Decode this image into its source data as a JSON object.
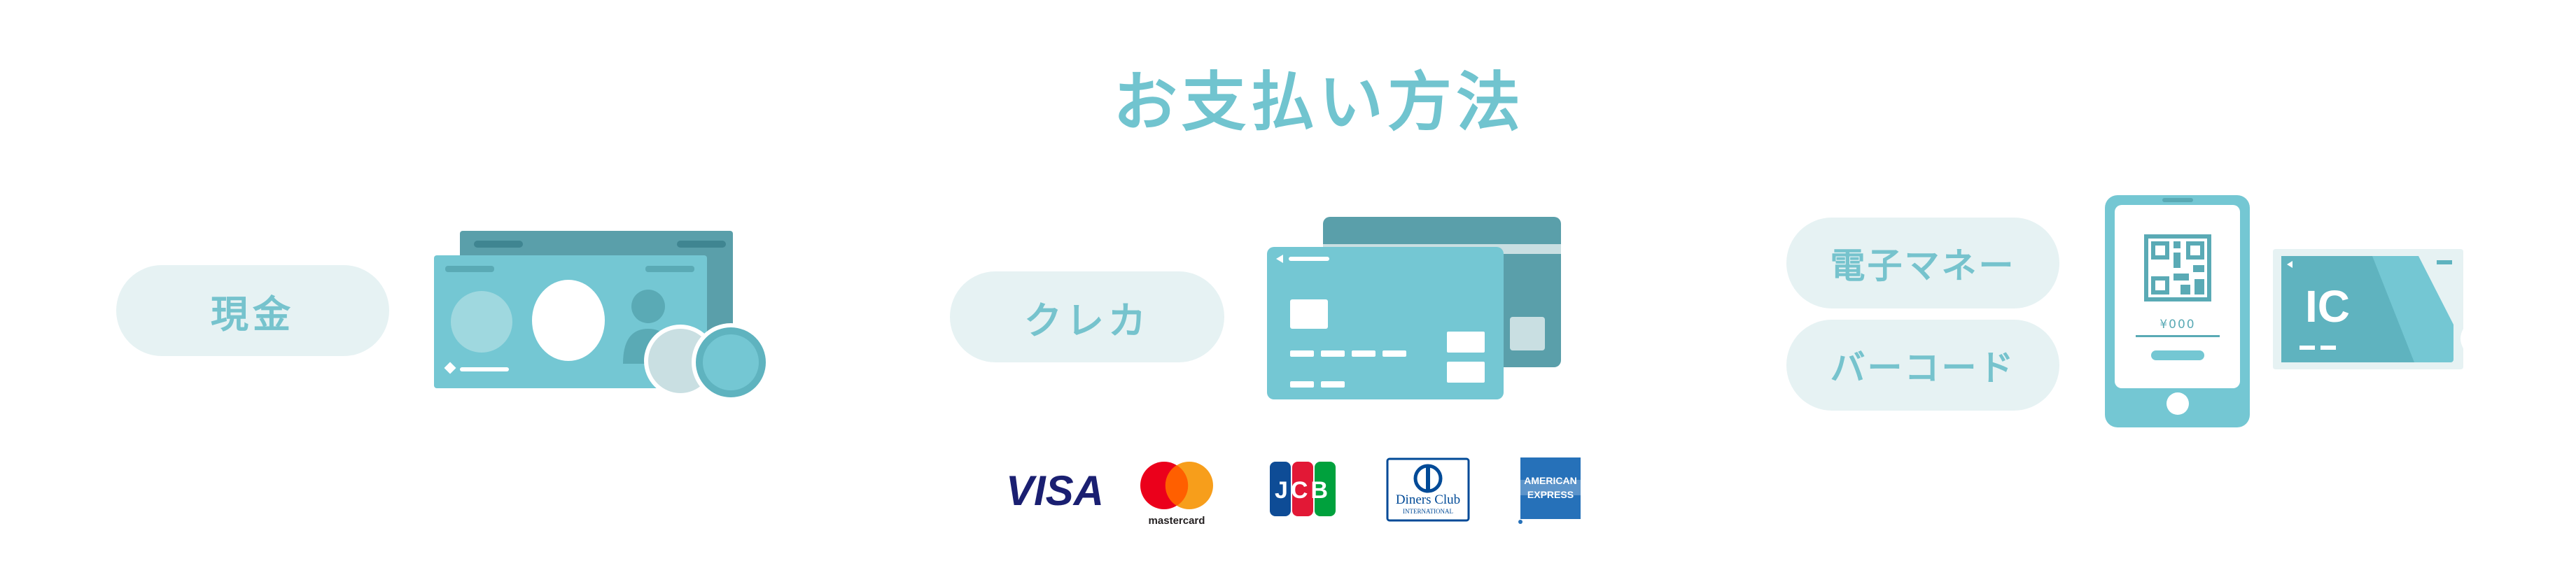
{
  "title": "お支払い方法",
  "methods": {
    "cash": {
      "label": "現金"
    },
    "credit": {
      "label": "クレカ"
    },
    "emoney": {
      "label": "電子マネー"
    },
    "barcode": {
      "label": "バーコード"
    }
  },
  "phone": {
    "amount": "¥000"
  },
  "ic_card": {
    "label": "IC"
  },
  "brands": {
    "visa": "VISA",
    "mastercard": "mastercard",
    "jcb": "JCB",
    "diners_line1": "Diners Club",
    "diners_line2": "INTERNATIONAL",
    "amex_line1": "AMERICAN",
    "amex_line2": "EXPRESS"
  },
  "colors": {
    "accent": "#71c4cf",
    "pill_bg": "#e6f2f3",
    "card_main": "#74c7d3",
    "card_dark": "#5a9faa"
  }
}
